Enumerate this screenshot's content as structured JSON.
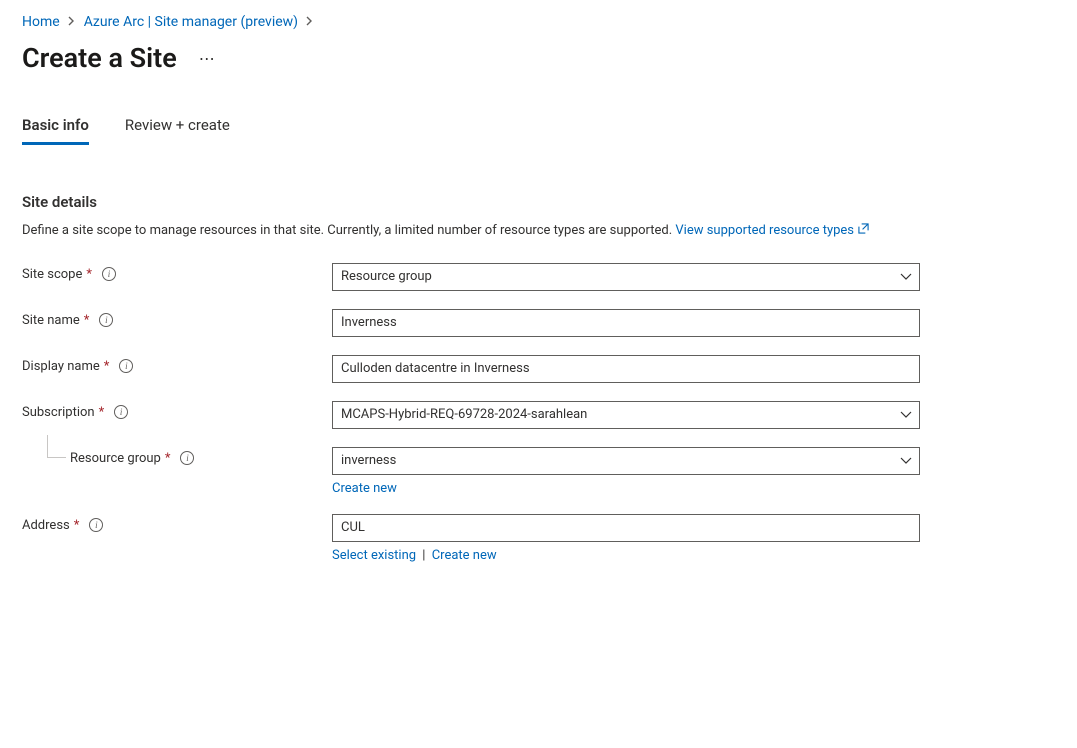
{
  "breadcrumb": {
    "home": "Home",
    "arc": "Azure Arc | Site manager (preview)"
  },
  "page": {
    "title": "Create a Site"
  },
  "tabs": {
    "basic": "Basic info",
    "review": "Review + create"
  },
  "section": {
    "title": "Site details",
    "desc_pre": "Define a site scope to manage resources in that site. Currently, a limited number of resource types are supported. ",
    "link": "View supported resource types"
  },
  "form": {
    "site_scope": {
      "label": "Site scope",
      "value": "Resource group"
    },
    "site_name": {
      "label": "Site name",
      "value": "Inverness"
    },
    "display_name": {
      "label": "Display name",
      "value": "Culloden datacentre in Inverness"
    },
    "subscription": {
      "label": "Subscription",
      "value": "MCAPS-Hybrid-REQ-69728-2024-sarahlean"
    },
    "resource_group": {
      "label": "Resource group",
      "value": "inverness",
      "create_new": "Create new"
    },
    "address": {
      "label": "Address",
      "value": "CUL",
      "select_existing": "Select existing",
      "create_new": "Create new"
    }
  }
}
